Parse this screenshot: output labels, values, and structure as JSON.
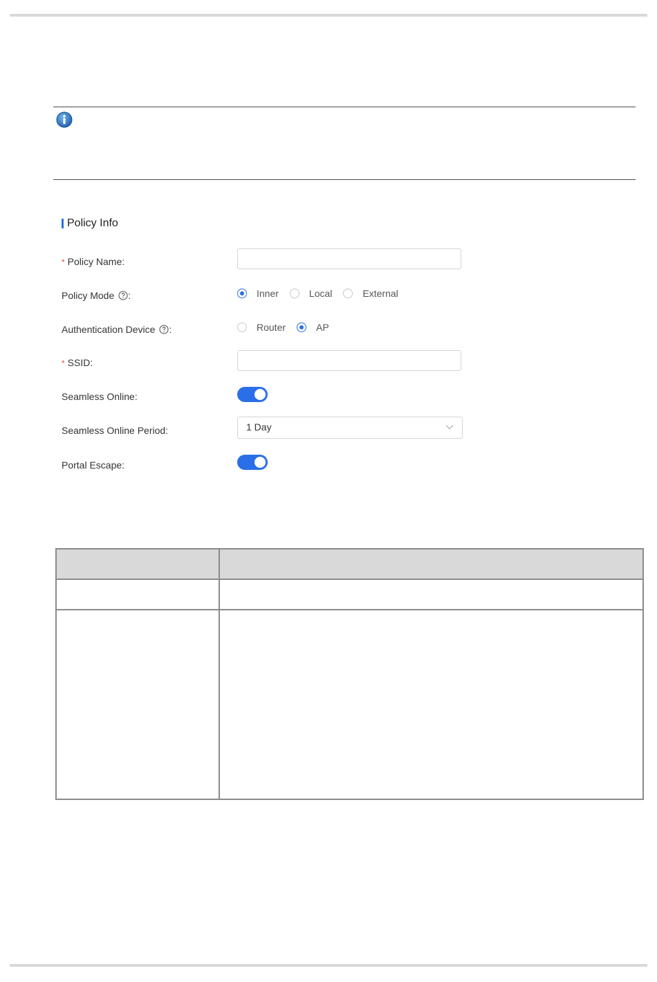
{
  "section": {
    "title": "Policy Info"
  },
  "form": {
    "policy_name": {
      "label": "Policy Name:",
      "value": ""
    },
    "policy_mode": {
      "label": "Policy Mode",
      "suffix": ":",
      "options": [
        "Inner",
        "Local",
        "External"
      ],
      "selected": "Inner"
    },
    "auth_device": {
      "label": "Authentication Device",
      "suffix": ":",
      "options": [
        "Router",
        "AP"
      ],
      "selected": "AP"
    },
    "ssid": {
      "label": "SSID:",
      "value": ""
    },
    "seamless_online": {
      "label": "Seamless Online:",
      "on": true
    },
    "seamless_period": {
      "label": "Seamless Online Period:",
      "value": "1 Day"
    },
    "portal_escape": {
      "label": "Portal Escape:",
      "on": true
    }
  },
  "required_mark": "*",
  "colors": {
    "accent": "#2b6fe8",
    "required": "#f04f3a",
    "info_icon": "#1f74c7"
  }
}
